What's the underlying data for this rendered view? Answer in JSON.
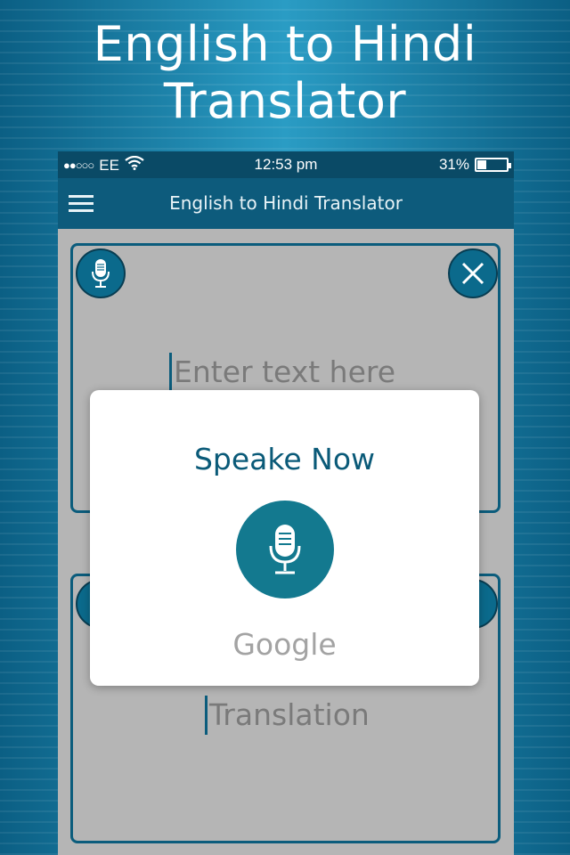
{
  "promo": {
    "line1": "English to Hindi",
    "line2": "Translator"
  },
  "status_bar": {
    "carrier": "EE",
    "time": "12:53 pm",
    "battery": "31%",
    "battery_level": 0.31
  },
  "app_bar": {
    "title": "English to Hindi Translator"
  },
  "input": {
    "placeholder": "Enter text here"
  },
  "output": {
    "placeholder": "Translation"
  },
  "dialog": {
    "title": "Speake Now",
    "footer": "Google"
  },
  "icons": {
    "menu": "menu-icon",
    "mic": "microphone-icon",
    "clear": "close-icon",
    "wifi": "wifi-icon"
  },
  "colors": {
    "accent": "#0d5b7c",
    "mic_bg": "#13798f",
    "dialog_title": "#0a5a78"
  }
}
